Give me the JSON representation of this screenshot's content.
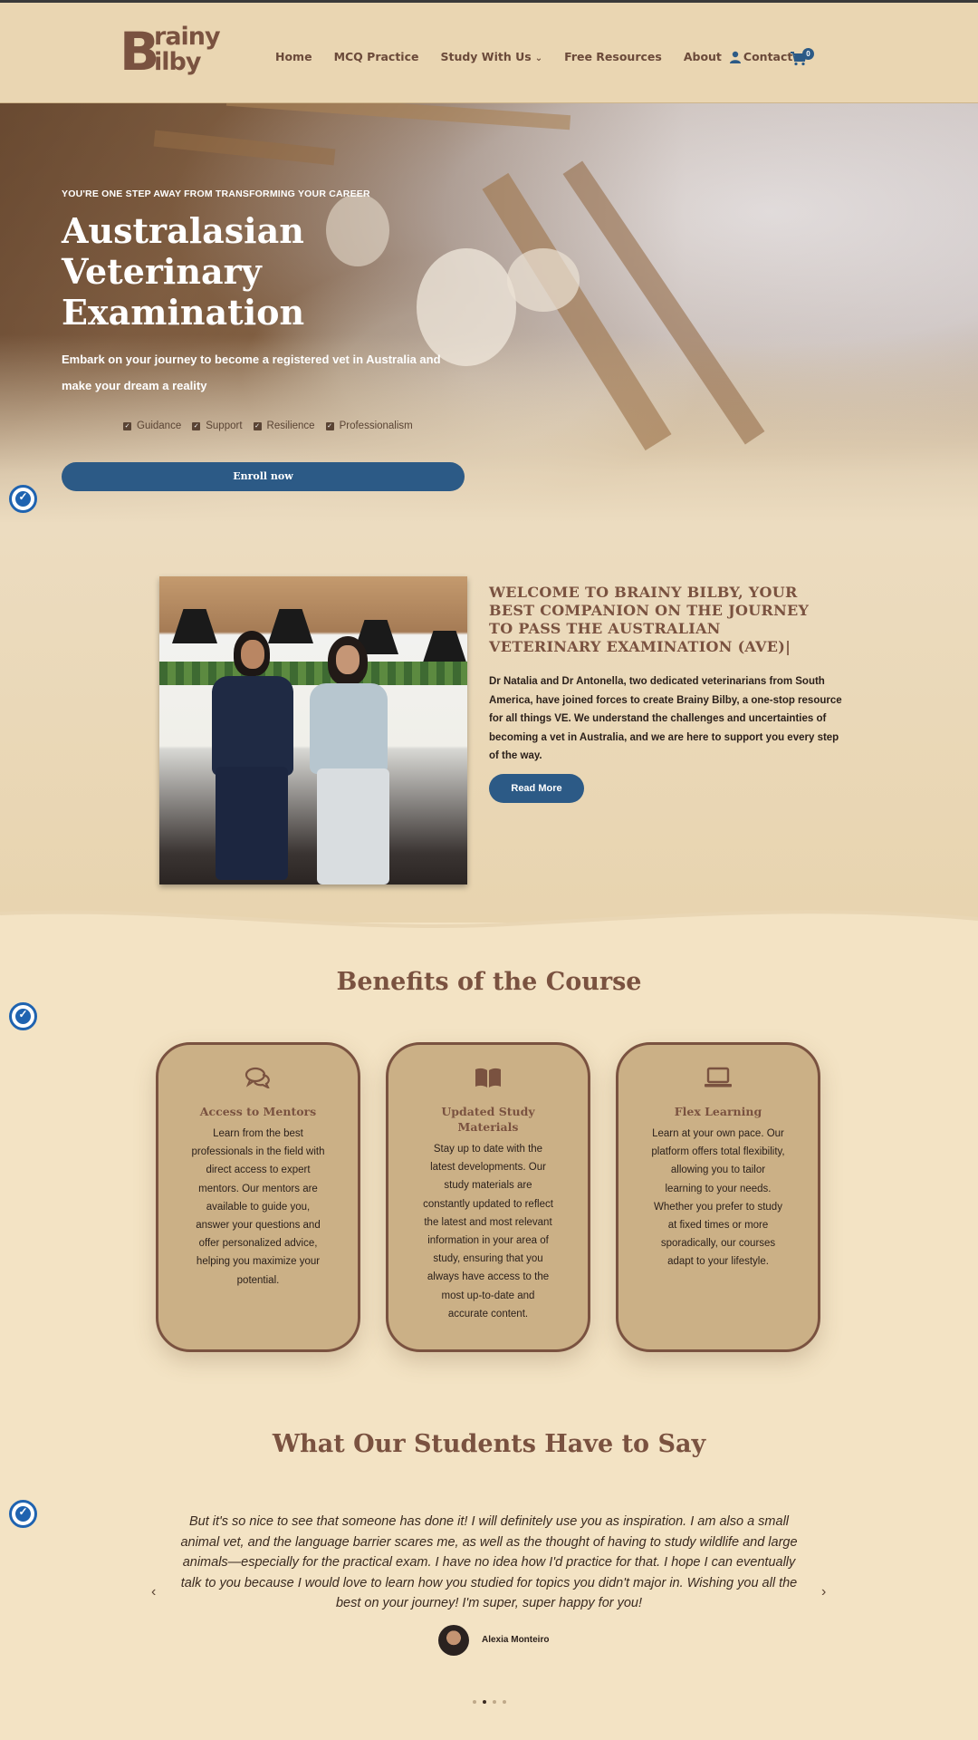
{
  "header": {
    "logo_top": "rainy",
    "logo_b": "B",
    "logo_bottom": "ilby",
    "nav": [
      {
        "label": "Home"
      },
      {
        "label": "MCQ Practice"
      },
      {
        "label": "Study With Us"
      },
      {
        "label": "Free Resources"
      },
      {
        "label": "About"
      },
      {
        "label": "Contact"
      }
    ],
    "cart_count": "0"
  },
  "hero": {
    "tagline": "YOU'RE ONE STEP AWAY FROM TRANSFORMING YOUR CAREER",
    "title": "Australasian Veterinary Examination",
    "subtitle": "Embark on your journey to become a registered vet in Australia and make your dream a reality",
    "checks": [
      "Guidance",
      "Support",
      "Resilience",
      "Professionalism"
    ],
    "cta": "Enroll now"
  },
  "welcome": {
    "title": "WELCOME TO BRAINY BILBY, YOUR BEST COMPANION ON THE JOURNEY TO PASS THE AUSTRALIAN VETERINARY EXAMINATION (AVE)|",
    "body": "Dr Natalia and Dr Antonella, two dedicated veterinarians from South America, have joined forces to create Brainy Bilby, a one-stop resource for all things VE. We understand the challenges and uncertainties of becoming a vet in Australia, and we are here to support you every step of the way.",
    "cta": "Read More"
  },
  "benefits": {
    "title": "Benefits of the Course",
    "cards": [
      {
        "icon": "chat-icon",
        "title": "Access to Mentors",
        "text": "Learn from the best professionals in the field with direct access to expert mentors. Our mentors are available to guide you, answer your questions and offer personalized advice, helping you maximize your potential."
      },
      {
        "icon": "book-icon",
        "title": "Updated Study Materials",
        "text": "Stay up to date with the latest developments. Our study materials are constantly updated to reflect the latest and most relevant information in your area of study, ensuring that you always have access to the most up-to-date and accurate content."
      },
      {
        "icon": "laptop-icon",
        "title": "Flex Learning",
        "text": "Learn at your own pace. Our platform offers total flexibility, allowing you to tailor learning to your needs. Whether you prefer to study at fixed times or more sporadically, our courses adapt to your lifestyle."
      }
    ]
  },
  "testimonials": {
    "title": "What Our Students Have to Say",
    "quote": "But it's so nice to see that someone has done it! I will definitely use you as inspiration. I am also a small animal vet, and the language barrier scares me, as well as the thought of having to study wildlife and large animals—especially for the practical exam. I have no idea how I'd practice for that. I hope I can eventually talk to you because I would love to learn how you studied for topics you didn't major in. Wishing you all the best on your journey! I'm super, super happy for you!",
    "author": "Alexia Monteiro",
    "prev": "‹",
    "next": "›",
    "active_slide": 2,
    "slide_count": 4
  },
  "colors": {
    "brand_brown": "#7a5240",
    "primary_blue": "#2c5a86",
    "background": "#f3e3c4"
  }
}
